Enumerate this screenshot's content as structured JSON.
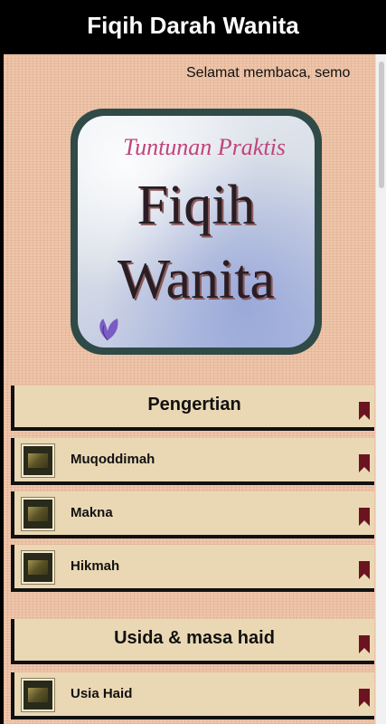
{
  "app": {
    "title": "Fiqih Darah Wanita"
  },
  "marquee": {
    "text": "Selamat membaca, semo"
  },
  "cover": {
    "subtitle": "Tuntunan Praktis",
    "title_line1": "Fiqih",
    "title_line2": "Wanita"
  },
  "sections": [
    {
      "title": "Pengertian",
      "items": [
        {
          "label": "Muqoddimah"
        },
        {
          "label": "Makna"
        },
        {
          "label": "Hikmah"
        }
      ]
    },
    {
      "title": "Usida & masa haid",
      "items": [
        {
          "label": "Usia Haid"
        }
      ]
    }
  ],
  "icons": {
    "bookmark": "bookmark-icon",
    "thumbnail": "book-thumbnail-icon"
  },
  "colors": {
    "header_bg": "#000000",
    "card_bg": "#ead8b4",
    "bookmark": "#6b1320",
    "page_bg": "#f0c6aa"
  }
}
